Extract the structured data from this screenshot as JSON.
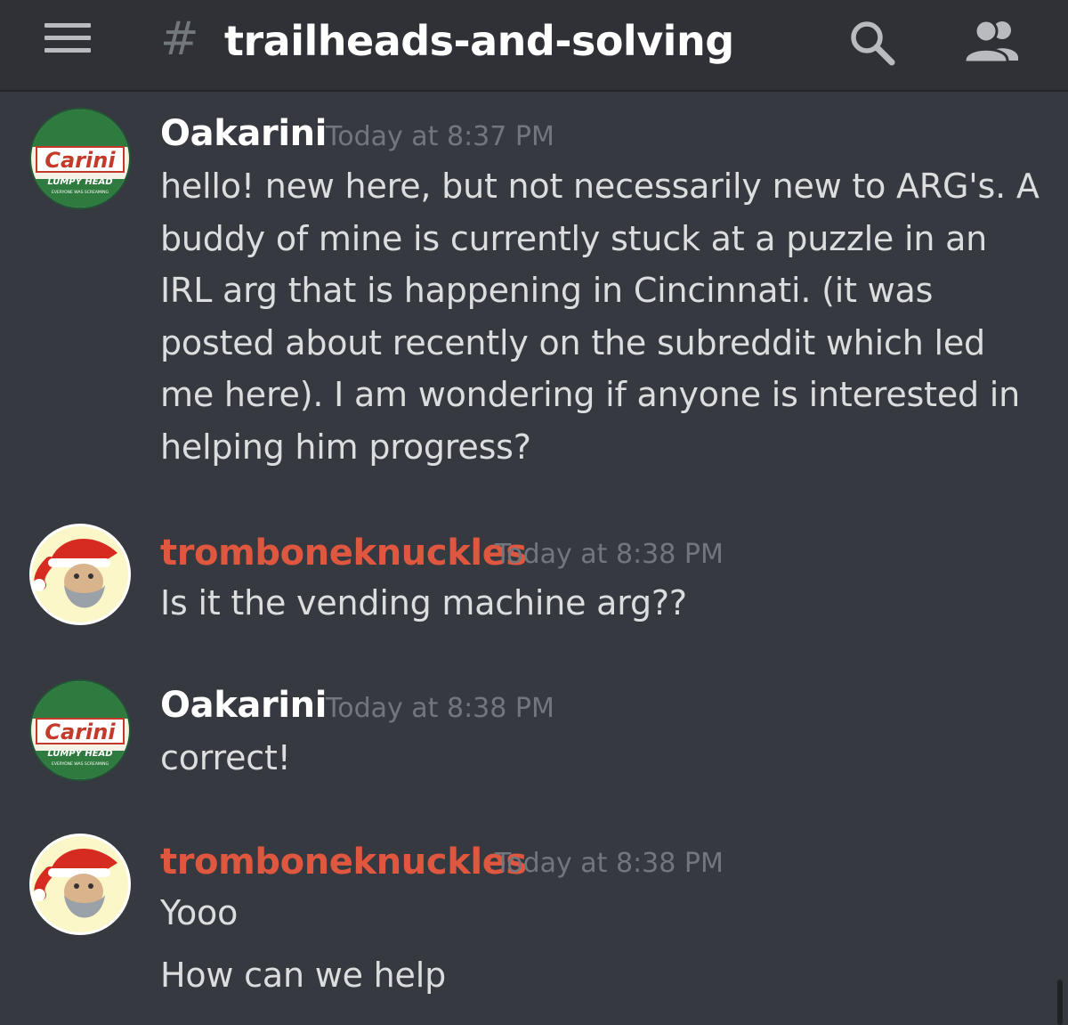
{
  "header": {
    "menu_icon": "hamburger-menu-icon",
    "hash_symbol": "#",
    "channel_name": "trailheads-and-solving",
    "search_icon": "search-icon",
    "members_icon": "members-icon"
  },
  "colors": {
    "background": "#36393f",
    "header_background": "#2f3136",
    "username_default": "#ffffff",
    "username_role": "#e0573f",
    "timestamp": "#72767d",
    "message_text": "#dcddde"
  },
  "avatar_text": {
    "brand": "Carini",
    "line1": "LUMPY HEAD",
    "line2": "EVERYONE WAS SCREAMING"
  },
  "messages": [
    {
      "author": "Oakarini",
      "avatar": "carini-logo-avatar",
      "timestamp": "Today at 8:37 PM",
      "lines": [
        "hello! new here, but not necessarily new to ARG's. A buddy of mine is currently stuck at a puzzle in an IRL arg that is happening in Cincinnati. (it was posted about recently on the subreddit which led me here). I am wondering if anyone is interested in helping him progress?"
      ]
    },
    {
      "author": "tromboneknuckles",
      "avatar": "santa-avatar",
      "timestamp": "Today at 8:38 PM",
      "lines": [
        "Is it the vending machine arg??"
      ]
    },
    {
      "author": "Oakarini",
      "avatar": "carini-logo-avatar",
      "timestamp": "Today at 8:38 PM",
      "lines": [
        "correct!"
      ]
    },
    {
      "author": "tromboneknuckles",
      "avatar": "santa-avatar",
      "timestamp": "Today at 8:38 PM",
      "lines": [
        "Yooo",
        "How can we help"
      ]
    }
  ]
}
